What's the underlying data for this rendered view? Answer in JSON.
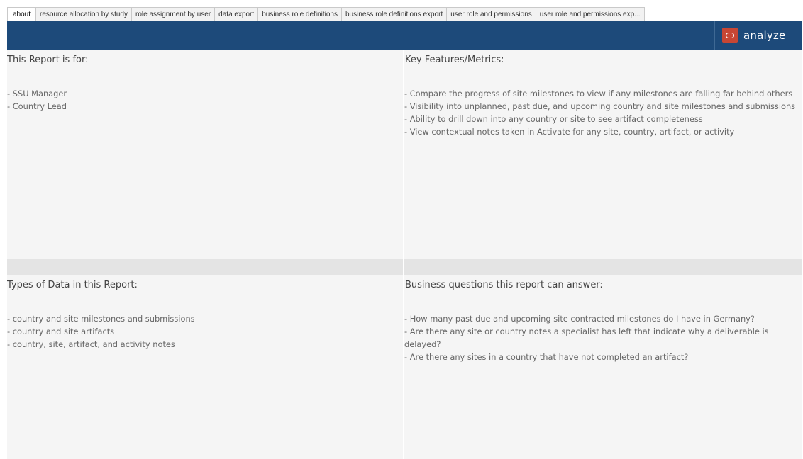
{
  "tabs": [
    {
      "label": "about",
      "active": true
    },
    {
      "label": "resource allocation by study",
      "active": false
    },
    {
      "label": "role assignment by user",
      "active": false
    },
    {
      "label": "data export",
      "active": false
    },
    {
      "label": "business role definitions",
      "active": false
    },
    {
      "label": "business role definitions export",
      "active": false
    },
    {
      "label": "user role and permissions",
      "active": false
    },
    {
      "label": "user role and permissions exp...",
      "active": false
    }
  ],
  "header": {
    "brand_label": "analyze",
    "brand_icon": "oracle-logo-icon",
    "colors": {
      "band": "#1d4a7a",
      "brand_accent": "#c74634"
    }
  },
  "panels": {
    "audience": {
      "title": "This Report is for:",
      "items": [
        "- SSU Manager",
        "- Country Lead"
      ]
    },
    "features": {
      "title": "Key Features/Metrics:",
      "items": [
        "- Compare the progress of site milestones to view if any milestones are falling far behind others",
        "- Visibility into unplanned, past due, and upcoming country and site milestones and submissions",
        "- Ability to drill down into any country or site to see artifact completeness",
        "- View contextual notes taken in Activate for any site, country, artifact, or activity"
      ]
    },
    "data_types": {
      "title": "Types of Data in this Report:",
      "items": [
        "- country and site milestones and submissions",
        "- country and site artifacts",
        "- country, site, artifact, and activity notes"
      ]
    },
    "questions": {
      "title": "Business questions this report can answer:",
      "items": [
        "- How many past due and upcoming site contracted milestones do I have in Germany?",
        "- Are there any site or country notes a specialist has left that indicate why a deliverable is delayed?",
        "- Are there any sites in a country that have not completed an artifact?"
      ]
    }
  }
}
